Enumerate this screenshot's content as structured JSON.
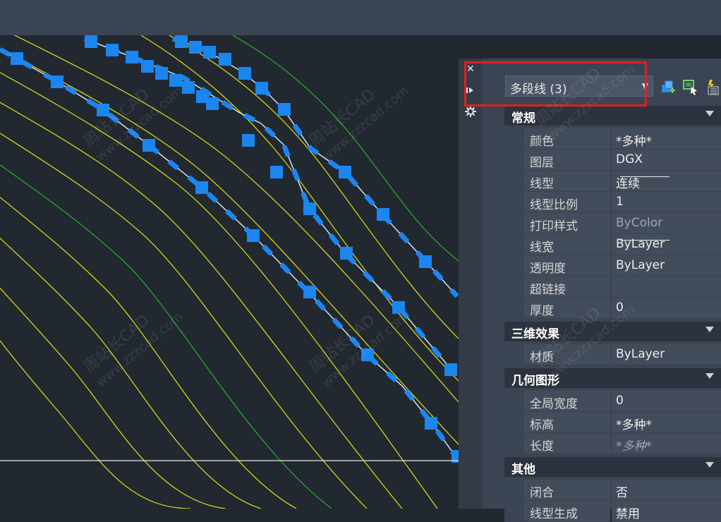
{
  "panel": {
    "selector": {
      "value": "多段线 (3)"
    },
    "sections": [
      {
        "title": "常规",
        "rows": [
          {
            "label": "颜色",
            "value": "*多种*"
          },
          {
            "label": "图层",
            "value": "DGX"
          },
          {
            "label": "线型",
            "value": "连续"
          },
          {
            "label": "线型比例",
            "value": "1"
          },
          {
            "label": "打印样式",
            "value": "ByColor"
          },
          {
            "label": "线宽",
            "value": "ByLayer"
          },
          {
            "label": "透明度",
            "value": "ByLayer"
          },
          {
            "label": "超链接",
            "value": ""
          },
          {
            "label": "厚度",
            "value": "0"
          }
        ]
      },
      {
        "title": "三维效果",
        "rows": [
          {
            "label": "材质",
            "value": "ByLayer"
          }
        ]
      },
      {
        "title": "几何图形",
        "rows": [
          {
            "label": "全局宽度",
            "value": "0"
          },
          {
            "label": "标高",
            "value": "*多种*"
          },
          {
            "label": "长度",
            "value": "*多种*"
          }
        ]
      },
      {
        "title": "其他",
        "rows": [
          {
            "label": "闭合",
            "value": "否"
          },
          {
            "label": "线型生成",
            "value": "禁用"
          }
        ]
      }
    ]
  },
  "watermark": {
    "text1": "周站长CAD",
    "text2": "www.zzzcad.com"
  },
  "colors": {
    "canvas": "#212830",
    "panel": "#3b4453",
    "contour_yellow": "#d6d31c",
    "contour_green": "#2ea42e",
    "grip_blue": "#1b86f0",
    "highlight_red": "#e02020"
  },
  "icons": [
    "close-icon",
    "pin-icon",
    "settings-icon",
    "dropdown-arrow-icon",
    "quick-select-icon",
    "select-objects-icon",
    "toggle-pickadd-icon"
  ]
}
